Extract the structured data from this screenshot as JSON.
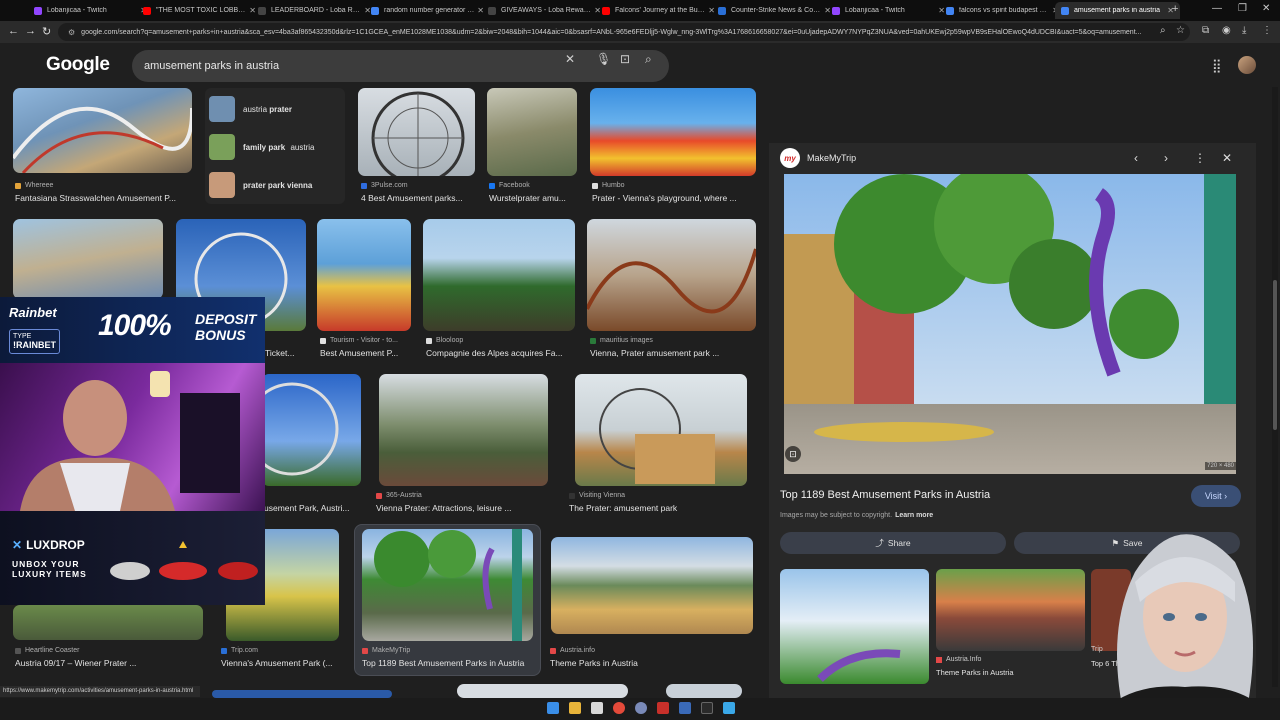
{
  "browser": {
    "tabs": [
      {
        "title": "Lobanjicaa - Twitch",
        "color": "#9146ff",
        "active": false
      },
      {
        "title": "\"THE MOST TOXIC LOBBY IN ...",
        "color": "#ff0000",
        "active": false
      },
      {
        "title": "LEADERBOARD - Loba Rewards",
        "color": "#333333",
        "active": false
      },
      {
        "title": "random number generator - ...",
        "color": "#4285f4",
        "active": false
      },
      {
        "title": "GIVEAWAYS - Loba Rewards",
        "color": "#333333",
        "active": false
      },
      {
        "title": "Falcons' Journey at the Budap...",
        "color": "#ff0000",
        "active": false
      },
      {
        "title": "Counter-Strike News & Cove...",
        "color": "#2a6fd6",
        "active": false
      },
      {
        "title": "Lobanjicaa - Twitch",
        "color": "#9146ff",
        "active": false
      },
      {
        "title": "falcons vs spirit budapest ma...",
        "color": "#4285f4",
        "active": false
      },
      {
        "title": "amusement parks in austria",
        "color": "#4285f4",
        "active": true
      }
    ],
    "url": "google.com/search?q=amusement+parks+in+austria&sca_esv=4ba3af865432350d&rlz=1C1GCEA_enME1028ME1038&udm=2&biw=2048&bih=1044&aic=0&bsasrf=ANbL-965e6FEDljj5-Wglw_nng-3WlTrg%3A1768616658027&ei=0uUjadepADWY7NYPqZ3NUA&ved=0ahUKEwj2p59wpVB9sEHalOEwoQ4dUDCBI&uact=5&oq=amusement..."
  },
  "google": {
    "logo": "Google",
    "query": "amusement parks in austria"
  },
  "related_searches": [
    {
      "prefix": "austria",
      "term": "prater",
      "color": "#6f8fb0"
    },
    {
      "prefix": "family park",
      "term": "austria",
      "color": "#7aa05a"
    },
    {
      "prefix": "prater park vienna",
      "term": "",
      "color": "#c79a7a"
    }
  ],
  "results": [
    {
      "source": "Whereee",
      "title": "Fantasiana Strasswalchen Amusement P...",
      "color": "#e3a33a"
    },
    {
      "source": "3Pulse.com",
      "title": "4 Best Amusement parks...",
      "color": "#2f6de0"
    },
    {
      "source": "Facebook",
      "title": "Wurstelprater amu...",
      "color": "#1877f2"
    },
    {
      "source": "Humbo",
      "title": "Prater - Vienna's playground, where ...",
      "color": "#ddd"
    },
    {
      "source": "",
      "title": "Ticket...",
      "color": "#888"
    },
    {
      "source": "Tourism - Visitor - to...",
      "title": "Best Amusement P...",
      "color": "#e0e0e0"
    },
    {
      "source": "Blooloop",
      "title": "Compagnie des Alpes acquires Fa...",
      "color": "#ddd"
    },
    {
      "source": "mauritius images",
      "title": "Vienna, Prater amusement park ...",
      "color": "#2a7a3a"
    },
    {
      "source": "",
      "title": "usement Park, Austri...",
      "color": "#888"
    },
    {
      "source": "365-Austria",
      "title": "Vienna Prater: Attractions, leisure ...",
      "color": "#e34848"
    },
    {
      "source": "Visiting Vienna",
      "title": "The Prater: amusement park",
      "color": "#333"
    },
    {
      "source": "Heartline Coaster",
      "title": "Austria 09/17 – Wiener Prater ...",
      "color": "#555"
    },
    {
      "source": "Trip.com",
      "title": "Vienna's Amusement Park (...",
      "color": "#2a6fd6"
    },
    {
      "source": "MakeMyTrip",
      "title": "Top 1189 Best Amusement Parks in Austria",
      "color": "#e34848"
    },
    {
      "source": "Austria.info",
      "title": "Theme Parks in Austria",
      "color": "#e34848"
    }
  ],
  "preview": {
    "site": "MakeMyTrip",
    "logo_text": "my",
    "dimensions": "720 × 480",
    "title": "Top 1189 Best Amusement Parks in Austria",
    "visit_label": "Visit",
    "copyright": "Images may be subject to copyright.",
    "learn_more": "Learn more",
    "share_label": "Share",
    "save_label": "Save",
    "related": [
      {
        "source": "",
        "title": ""
      },
      {
        "source": "Austria.Info",
        "title": "Theme Parks in Austria"
      },
      {
        "source": "Trip",
        "title": "Top 6 Th"
      }
    ]
  },
  "status_url": "https://www.makemytrip.com/activities/amusement-parks-in-austria.html",
  "overlays": {
    "rainbet": {
      "logo": "Rainbet",
      "type_label": "TYPE",
      "code": "!RAINBET",
      "big": "100%",
      "deposit": "DEPOSIT",
      "bonus": "BONUS"
    },
    "luxdrop": {
      "logo": "LUXDROP",
      "line1": "UNBOX YOUR",
      "line2": "LUXURY ITEMS"
    }
  }
}
